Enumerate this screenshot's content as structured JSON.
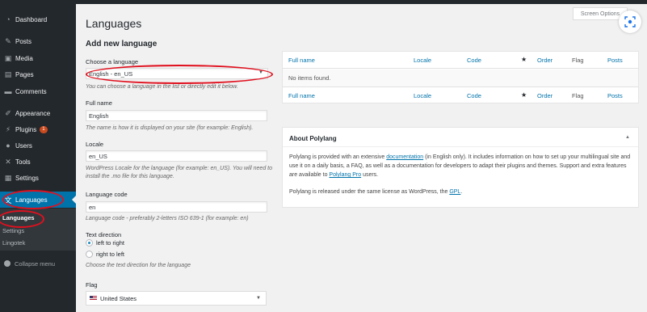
{
  "sidebar": {
    "items": [
      {
        "label": "Dashboard",
        "icon": "dashboard-icon",
        "glyph": "◔"
      },
      {
        "label": "Posts",
        "icon": "pushpin-icon",
        "glyph": "✎"
      },
      {
        "label": "Media",
        "icon": "media-icon",
        "glyph": "▣"
      },
      {
        "label": "Pages",
        "icon": "pages-icon",
        "glyph": "▤"
      },
      {
        "label": "Comments",
        "icon": "comments-icon",
        "glyph": "▬"
      },
      {
        "label": "Appearance",
        "icon": "appearance-icon",
        "glyph": "✐"
      },
      {
        "label": "Plugins",
        "icon": "plugins-icon",
        "glyph": "⚡",
        "badge": "1"
      },
      {
        "label": "Users",
        "icon": "users-icon",
        "glyph": "●"
      },
      {
        "label": "Tools",
        "icon": "tools-icon",
        "glyph": "✕"
      },
      {
        "label": "Settings",
        "icon": "settings-icon",
        "glyph": "▦"
      },
      {
        "label": "Languages",
        "icon": "languages-icon",
        "glyph": "文"
      }
    ],
    "submenu": [
      "Languages",
      "Settings",
      "Lingotek"
    ],
    "collapse": "Collapse menu"
  },
  "screen_options": "Screen Options",
  "page_title": "Languages",
  "form": {
    "section_title": "Add new language",
    "choose_label": "Choose a language",
    "choose_value": "English - en_US",
    "choose_desc": "You can choose a language in the list or directly edit it below.",
    "fullname_label": "Full name",
    "fullname_value": "English",
    "fullname_desc": "The name is how it is displayed on your site (for example: English).",
    "locale_label": "Locale",
    "locale_value": "en_US",
    "locale_desc": "WordPress Locale for the language (for example: en_US). You will need to install the .mo file for this language.",
    "code_label": "Language code",
    "code_value": "en",
    "code_desc": "Language code - preferably 2-letters ISO 639-1 (for example: en)",
    "direction_label": "Text direction",
    "direction_ltr": "left to right",
    "direction_rtl": "right to left",
    "direction_desc": "Choose the text direction for the language",
    "flag_label": "Flag",
    "flag_value": "United States"
  },
  "table": {
    "columns": {
      "full_name": "Full name",
      "locale": "Locale",
      "code": "Code",
      "order": "Order",
      "flag": "Flag",
      "posts": "Posts"
    },
    "empty": "No items found."
  },
  "about": {
    "title": "About Polylang",
    "p1_a": "Polylang is provided with an extensive ",
    "p1_link1": "documentation",
    "p1_b": " (in English only). It includes information on how to set up your multilingual site and use it on a daily basis, a FAQ, as well as a documentation for developers to adapt their plugins and themes. Support and extra features are available to ",
    "p1_link2": "Polylang Pro",
    "p1_c": " users.",
    "p2_a": "Polylang is released under the same license as WordPress, the ",
    "p2_link": "GPL",
    "p2_b": "."
  },
  "colors": {
    "accent": "#0073aa",
    "sidebar": "#23282d",
    "annotation": "#e0101e"
  }
}
